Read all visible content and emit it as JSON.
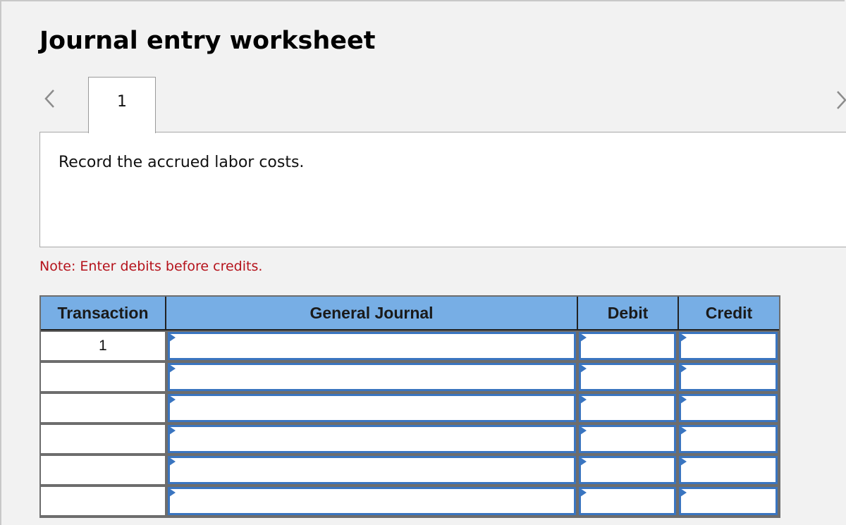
{
  "title": "Journal entry worksheet",
  "navigation": {
    "prev_icon": "chevron-left-icon",
    "next_icon": "chevron-right-icon",
    "tabs": [
      {
        "label": "1",
        "active": true
      }
    ]
  },
  "panel": {
    "instruction": "Record the accrued labor costs."
  },
  "note": {
    "text": "Note: Enter debits before credits.",
    "color": "#b5121b"
  },
  "table": {
    "header_color": "#77aee5",
    "input_border_color": "#3a75c0",
    "columns": [
      "Transaction",
      "General Journal",
      "Debit",
      "Credit"
    ],
    "rows": [
      {
        "transaction": "1",
        "account": "",
        "debit": "",
        "credit": ""
      },
      {
        "transaction": "",
        "account": "",
        "debit": "",
        "credit": ""
      },
      {
        "transaction": "",
        "account": "",
        "debit": "",
        "credit": ""
      },
      {
        "transaction": "",
        "account": "",
        "debit": "",
        "credit": ""
      },
      {
        "transaction": "",
        "account": "",
        "debit": "",
        "credit": ""
      },
      {
        "transaction": "",
        "account": "",
        "debit": "",
        "credit": ""
      }
    ]
  }
}
